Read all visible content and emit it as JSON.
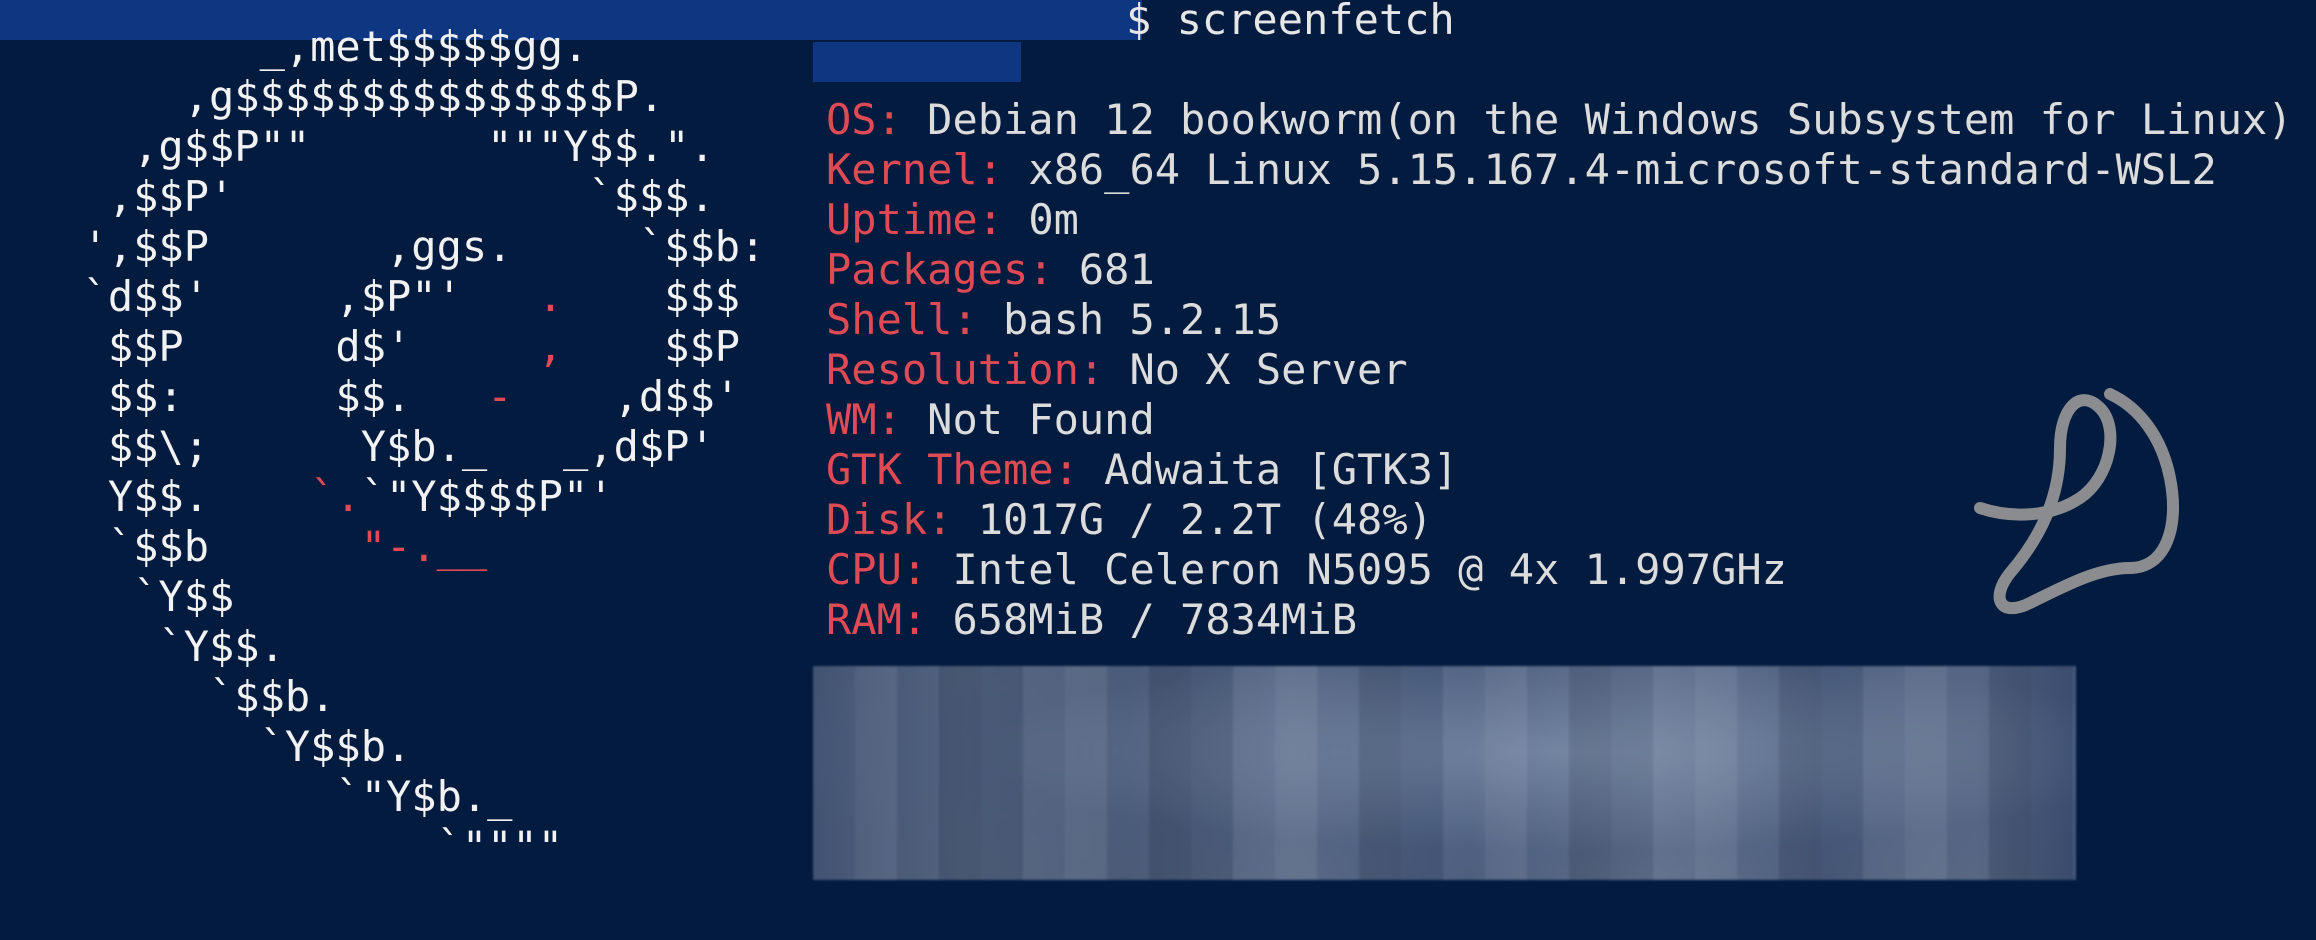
{
  "terminal": {
    "prompt_suffix": "$ screenfetch",
    "colors": {
      "background": "#021b3f",
      "label": "#e04a55",
      "text": "#dcdcdc",
      "redaction": "#0f3680"
    }
  },
  "logo": {
    "name": "debian-swirl-ascii",
    "lines": [
      {
        "t1": "         _,met$$$$$gg.",
        "r": "",
        "t2": ""
      },
      {
        "t1": "      ,g$$$$$$$$$$$$$$$P.",
        "r": "",
        "t2": ""
      },
      {
        "t1": "    ,g$$P\"\"       \"\"\"Y$$.\".",
        "r": "",
        "t2": ""
      },
      {
        "t1": "   ,$$P'              `$$$.",
        "r": "",
        "t2": ""
      },
      {
        "t1": "  ',$$P       ,ggs.     `$$b:",
        "r": "",
        "t2": ""
      },
      {
        "t1": "  `d$$'     ,$P\"'   ",
        "r": ".",
        "t2": "    $$$"
      },
      {
        "t1": "   $$P      d$'     ",
        "r": ",",
        "t2": "    $$P"
      },
      {
        "t1": "   $$:      $$.   ",
        "r": "-",
        "t2": "    ,d$$'"
      },
      {
        "t1": "   $$\\;      Y$b._   _,d$P'",
        "r": "",
        "t2": ""
      },
      {
        "t1": "   Y$$.    ",
        "r": "`.",
        "t2": "`\"Y$$$$P\"'"
      },
      {
        "t1": "   `$$b      ",
        "r": "\"-.__",
        "t2": ""
      },
      {
        "t1": "    `Y$$",
        "r": "",
        "t2": ""
      },
      {
        "t1": "     `Y$$.",
        "r": "",
        "t2": ""
      },
      {
        "t1": "       `$$b.",
        "r": "",
        "t2": ""
      },
      {
        "t1": "         `Y$$b.",
        "r": "",
        "t2": ""
      },
      {
        "t1": "            `\"Y$b._",
        "r": "",
        "t2": ""
      },
      {
        "t1": "                `\"\"\"\"",
        "r": "",
        "t2": ""
      }
    ]
  },
  "sysinfo": {
    "os": {
      "label": "OS:",
      "value": "Debian 12 bookworm(on the Windows Subsystem for Linux)"
    },
    "kernel": {
      "label": "Kernel:",
      "value": "x86_64 Linux 5.15.167.4-microsoft-standard-WSL2"
    },
    "uptime": {
      "label": "Uptime:",
      "value": "0m"
    },
    "packages": {
      "label": "Packages:",
      "value": "681"
    },
    "shell": {
      "label": "Shell:",
      "value": "bash 5.2.15"
    },
    "resolution": {
      "label": "Resolution:",
      "value": "No X Server"
    },
    "wm": {
      "label": "WM:",
      "value": "Not Found"
    },
    "gtk_theme": {
      "label": "GTK Theme:",
      "value": "Adwaita [GTK3]"
    },
    "disk": {
      "label": "Disk:",
      "value": "1017G / 2.2T (48%)"
    },
    "cpu": {
      "label": "CPU:",
      "value": "Intel Celeron N5095 @ 4x 1.997GHz"
    },
    "ram": {
      "label": "RAM:",
      "value": "658MiB / 7834MiB"
    }
  }
}
